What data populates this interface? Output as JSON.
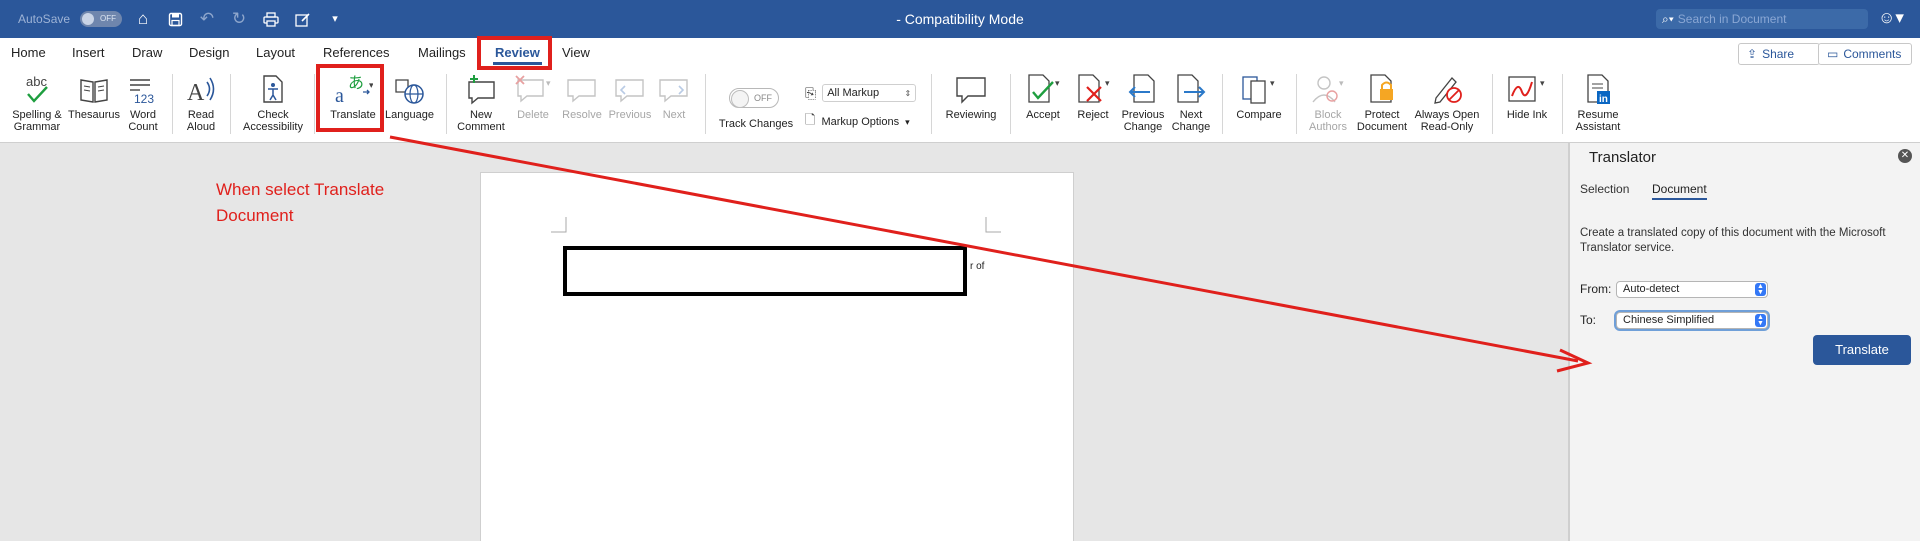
{
  "titlebar": {
    "autosave_label": "AutoSave",
    "autosave_state": "OFF",
    "document_title": "-  Compatibility Mode",
    "search_placeholder": "Search in Document"
  },
  "tabs": [
    {
      "label": "Home"
    },
    {
      "label": "Insert"
    },
    {
      "label": "Draw"
    },
    {
      "label": "Design"
    },
    {
      "label": "Layout"
    },
    {
      "label": "References"
    },
    {
      "label": "Mailings"
    },
    {
      "label": "Review",
      "active": true
    },
    {
      "label": "View"
    }
  ],
  "top_actions": {
    "share": "Share",
    "comments": "Comments"
  },
  "ribbon": {
    "spelling": [
      "Spelling &",
      "Grammar"
    ],
    "thesaurus": "Thesaurus",
    "word_count": [
      "Word",
      "Count"
    ],
    "read_aloud": [
      "Read",
      "Aloud"
    ],
    "check_accessibility": [
      "Check",
      "Accessibility"
    ],
    "translate": "Translate",
    "language": "Language",
    "new_comment": [
      "New",
      "Comment"
    ],
    "delete": "Delete",
    "resolve": "Resolve",
    "previous": "Previous",
    "next": "Next",
    "track_changes": "Track Changes",
    "track_changes_state": "OFF",
    "all_markup": "All Markup",
    "markup_options": "Markup Options",
    "reviewing": "Reviewing",
    "accept": "Accept",
    "reject": "Reject",
    "previous_change": [
      "Previous",
      "Change"
    ],
    "next_change": [
      "Next",
      "Change"
    ],
    "compare": "Compare",
    "block_authors": [
      "Block",
      "Authors"
    ],
    "protect_document": [
      "Protect",
      "Document"
    ],
    "always_open": [
      "Always Open",
      "Read-Only"
    ],
    "hide_ink": "Hide Ink",
    "resume_assistant": [
      "Resume",
      "Assistant"
    ]
  },
  "annotation": {
    "line1": "When select Translate",
    "line2": "Document",
    "color": "#e0201c"
  },
  "page": {
    "fragment": "r of"
  },
  "translator": {
    "title": "Translator",
    "tabs": [
      "Selection",
      "Document"
    ],
    "active_tab": "Document",
    "description": "Create a translated copy of this document with the Microsoft Translator service.",
    "from_label": "From:",
    "from_value": "Auto-detect",
    "to_label": "To:",
    "to_value": "Chinese Simplified",
    "button": "Translate"
  },
  "colors": {
    "brand": "#2b579a",
    "annotation": "#e0201c"
  }
}
